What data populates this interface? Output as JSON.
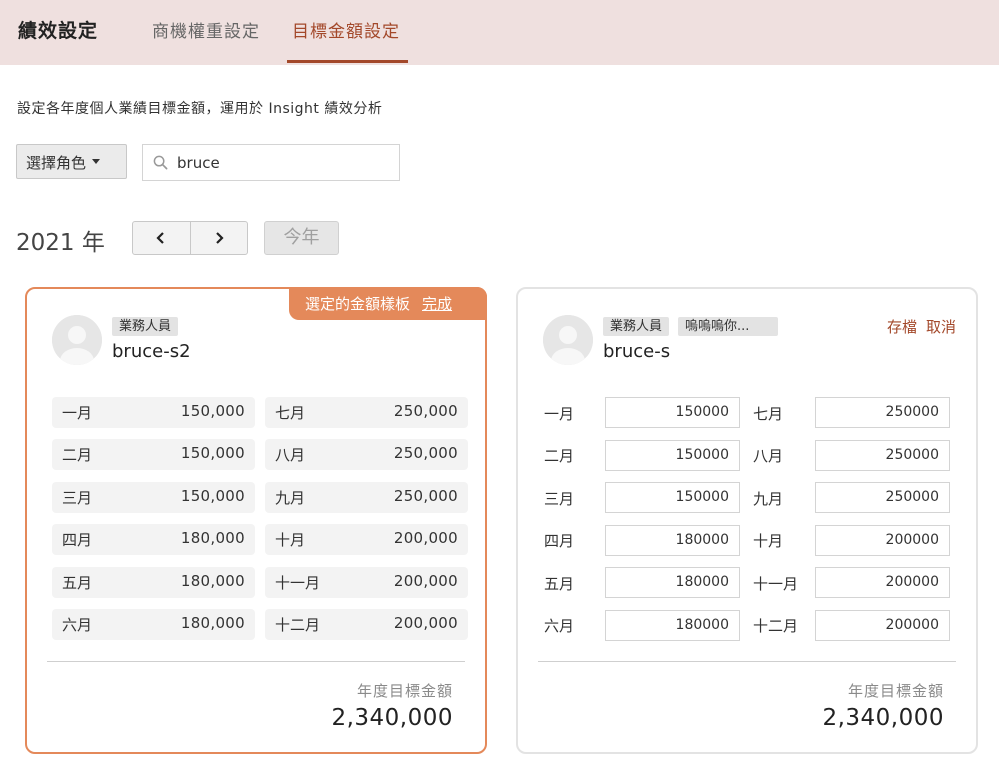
{
  "header": {
    "title": "績效設定",
    "tabs": [
      {
        "label": "商機權重設定",
        "active": false
      },
      {
        "label": "目標金額設定",
        "active": true
      }
    ]
  },
  "description": "設定各年度個人業績目標金額，運用於 Insight 績效分析",
  "filters": {
    "role_select_label": "選擇角色",
    "search_value": "bruce"
  },
  "year_nav": {
    "year_label": "2021 年",
    "this_year_label": "今年"
  },
  "cards": [
    {
      "badges": [
        "業務人員"
      ],
      "name": "bruce-s2",
      "template_label": "選定的金額樣板",
      "template_done": "完成",
      "months": [
        {
          "name": "一月",
          "value": "150,000"
        },
        {
          "name": "二月",
          "value": "150,000"
        },
        {
          "name": "三月",
          "value": "150,000"
        },
        {
          "name": "四月",
          "value": "180,000"
        },
        {
          "name": "五月",
          "value": "180,000"
        },
        {
          "name": "六月",
          "value": "180,000"
        },
        {
          "name": "七月",
          "value": "250,000"
        },
        {
          "name": "八月",
          "value": "250,000"
        },
        {
          "name": "九月",
          "value": "250,000"
        },
        {
          "name": "十月",
          "value": "200,000"
        },
        {
          "name": "十一月",
          "value": "200,000"
        },
        {
          "name": "十二月",
          "value": "200,000"
        }
      ],
      "total_label": "年度目標金額",
      "total_value": "2,340,000"
    },
    {
      "badges": [
        "業務人員",
        "嗚嗚嗚你..."
      ],
      "name": "bruce-s",
      "save_label": "存檔",
      "cancel_label": "取消",
      "months": [
        {
          "name": "一月",
          "value": "150000"
        },
        {
          "name": "二月",
          "value": "150000"
        },
        {
          "name": "三月",
          "value": "150000"
        },
        {
          "name": "四月",
          "value": "180000"
        },
        {
          "name": "五月",
          "value": "180000"
        },
        {
          "name": "六月",
          "value": "180000"
        },
        {
          "name": "七月",
          "value": "250000"
        },
        {
          "name": "八月",
          "value": "250000"
        },
        {
          "name": "九月",
          "value": "250000"
        },
        {
          "name": "十月",
          "value": "200000"
        },
        {
          "name": "十一月",
          "value": "200000"
        },
        {
          "name": "十二月",
          "value": "200000"
        }
      ],
      "total_label": "年度目標金額",
      "total_value": "2,340,000"
    }
  ],
  "colors": {
    "accent": "#a3482a",
    "card_highlight": "#e4895a",
    "header_bg": "#efe0df"
  },
  "icons": {
    "search": "search-icon",
    "prev": "chevron-left-icon",
    "next": "chevron-right-icon",
    "avatar": "user-avatar-icon"
  }
}
